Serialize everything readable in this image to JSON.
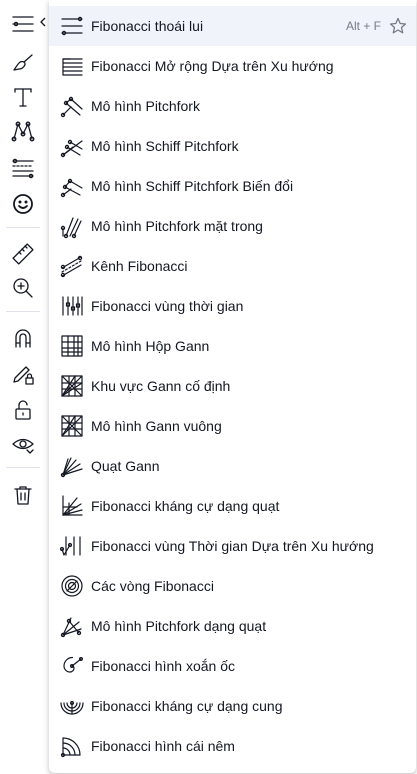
{
  "toolbar": {
    "tools": [
      {
        "name": "lines-menu-icon"
      },
      {
        "name": "brush-icon"
      },
      {
        "name": "text-icon"
      },
      {
        "name": "patterns-icon"
      },
      {
        "name": "fib-gann-icon"
      },
      {
        "name": "emoji-icon"
      },
      {
        "name": "ruler-icon"
      },
      {
        "name": "zoom-in-icon"
      },
      {
        "name": "magnet-icon"
      },
      {
        "name": "lock-drawing-icon"
      },
      {
        "name": "unlock-icon"
      },
      {
        "name": "eye-icon"
      },
      {
        "name": "trash-icon"
      }
    ]
  },
  "menu": {
    "items": [
      {
        "label": "Fibonacci thoái lui",
        "icon": "fib-retracement-icon",
        "shortcut": "Alt + F",
        "active": true
      },
      {
        "label": "Fibonacci Mở rộng Dựa trên Xu hướng",
        "icon": "trend-fib-extension-icon"
      },
      {
        "label": "Mô hình Pitchfork",
        "icon": "pitchfork-icon"
      },
      {
        "label": "Mô hình Schiff Pitchfork",
        "icon": "schiff-pitchfork-icon"
      },
      {
        "label": "Mô hình Schiff Pitchfork Biến đổi",
        "icon": "modified-schiff-pitchfork-icon"
      },
      {
        "label": "Mô hình Pitchfork mặt trong",
        "icon": "inside-pitchfork-icon"
      },
      {
        "label": "Kênh Fibonacci",
        "icon": "fib-channel-icon"
      },
      {
        "label": "Fibonacci vùng thời gian",
        "icon": "fib-timezone-icon"
      },
      {
        "label": "Mô hình Hộp Gann",
        "icon": "gann-box-icon"
      },
      {
        "label": "Khu vực Gann cố định",
        "icon": "gann-square-fixed-icon"
      },
      {
        "label": "Mô hình Gann vuông",
        "icon": "gann-square-icon"
      },
      {
        "label": "Quạt Gann",
        "icon": "gann-fan-icon"
      },
      {
        "label": "Fibonacci kháng cự dạng quạt",
        "icon": "fib-speed-fan-icon"
      },
      {
        "label": "Fibonacci vùng Thời gian Dựa trên Xu hướng",
        "icon": "trend-fib-time-icon"
      },
      {
        "label": "Các vòng Fibonacci",
        "icon": "fib-circles-icon"
      },
      {
        "label": "Mô hình Pitchfork dạng quạt",
        "icon": "pitchfan-icon"
      },
      {
        "label": "Fibonacci hình xoắn ốc",
        "icon": "fib-spiral-icon"
      },
      {
        "label": "Fibonacci kháng cự dạng cung",
        "icon": "fib-speed-arcs-icon"
      },
      {
        "label": "Fibonacci hình cái nêm",
        "icon": "fib-wedge-icon"
      }
    ]
  }
}
